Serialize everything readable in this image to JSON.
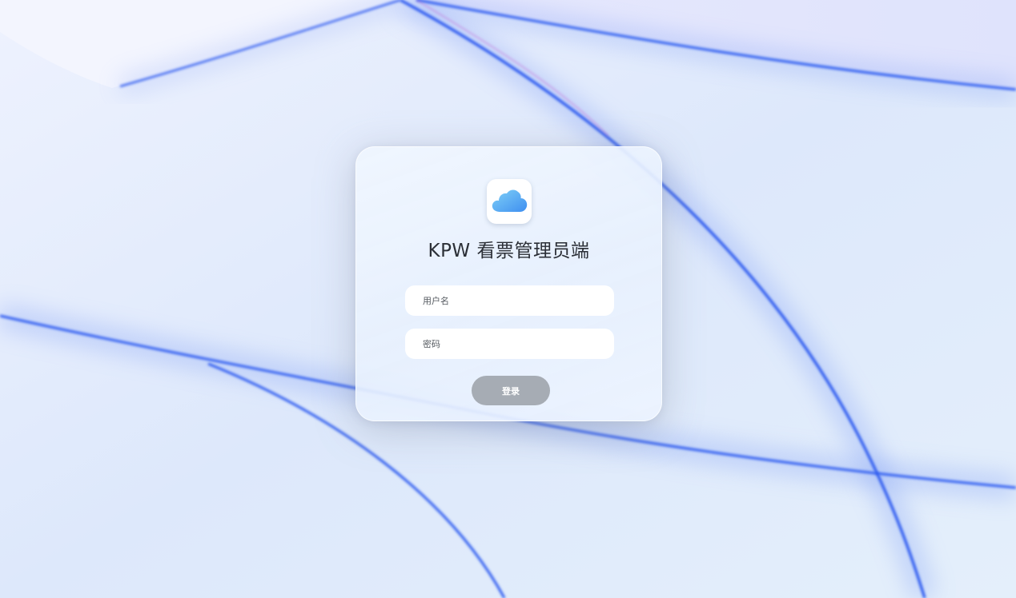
{
  "app": {
    "title": "KPW 看票管理员端",
    "icon": "cloud-icon"
  },
  "form": {
    "username_placeholder": "用户名",
    "username_value": "",
    "password_placeholder": "密码",
    "password_value": "",
    "login_label": "登录"
  },
  "colors": {
    "wallpaper_accent": "#2f5cf0",
    "button_background": "#a6acb4",
    "icon_gradient_start": "#7fd0f7",
    "icon_gradient_end": "#3f8ff0"
  }
}
